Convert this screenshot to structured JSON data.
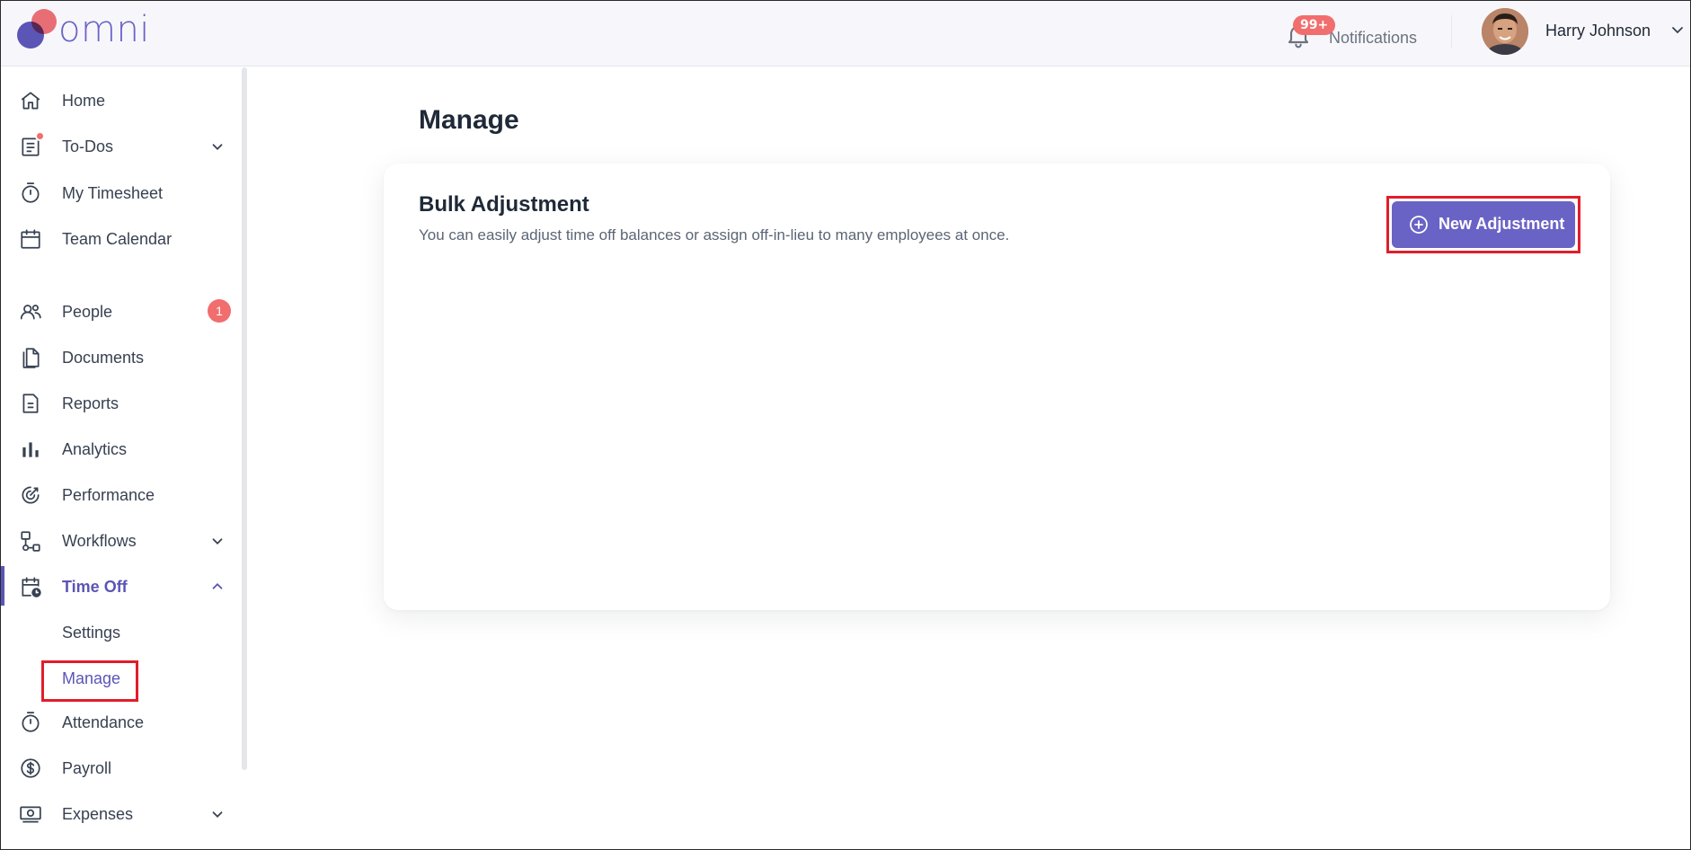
{
  "header": {
    "logo_text": "omni",
    "notifications_badge": "99+",
    "notifications_label": "Notifications",
    "user_name": "Harry Johnson"
  },
  "sidebar": {
    "items": [
      {
        "label": "Home",
        "icon": "home-icon"
      },
      {
        "label": "To-Dos",
        "icon": "todo-list-icon",
        "has_dot": true,
        "expandable": true
      },
      {
        "label": "My Timesheet",
        "icon": "stopwatch-icon"
      },
      {
        "label": "Team Calendar",
        "icon": "calendar-icon"
      },
      {
        "label": "People",
        "icon": "people-icon",
        "badge": "1"
      },
      {
        "label": "Documents",
        "icon": "documents-icon"
      },
      {
        "label": "Reports",
        "icon": "report-icon"
      },
      {
        "label": "Analytics",
        "icon": "bar-chart-icon"
      },
      {
        "label": "Performance",
        "icon": "performance-icon"
      },
      {
        "label": "Workflows",
        "icon": "workflow-icon",
        "expandable": true
      },
      {
        "label": "Time Off",
        "icon": "calendar-clock-icon",
        "expanded": true,
        "active": true
      },
      {
        "label": "Attendance",
        "icon": "stopwatch-icon"
      },
      {
        "label": "Payroll",
        "icon": "dollar-icon"
      },
      {
        "label": "Expenses",
        "icon": "cash-icon",
        "expandable": true
      }
    ],
    "time_off_sub": [
      "Settings",
      "Manage"
    ]
  },
  "main": {
    "page_title": "Manage",
    "card": {
      "title": "Bulk Adjustment",
      "description": "You can easily adjust time off balances or assign off-in-lieu to many employees at once.",
      "button_label": "New Adjustment"
    }
  },
  "colors": {
    "accent": "#6a63c6",
    "brand_coral": "#f07178",
    "badge": "#f26d6d",
    "highlight": "#e11d2a"
  }
}
